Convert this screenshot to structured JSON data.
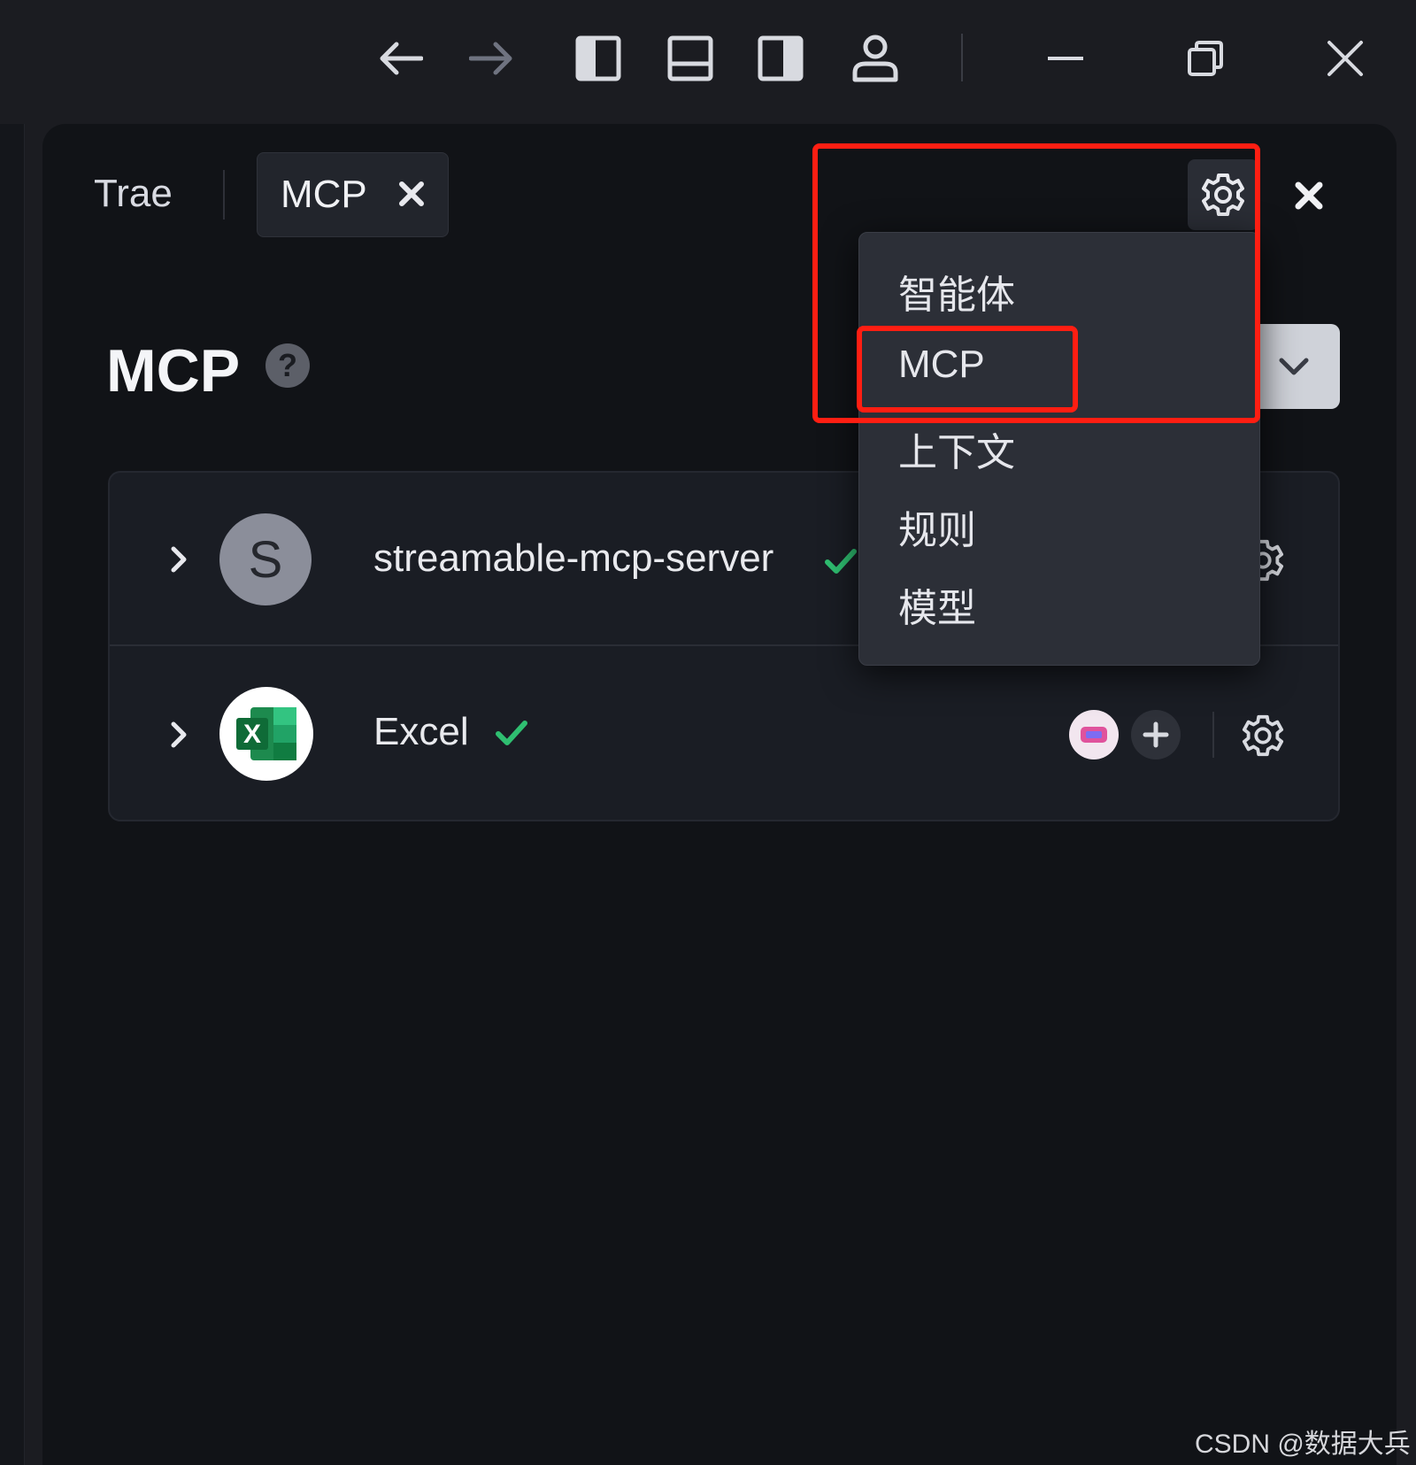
{
  "window": {
    "controls": [
      "arrow-left-icon",
      "arrow-right-icon",
      "toggle-left-panel-icon",
      "toggle-bottom-panel-icon",
      "toggle-right-panel-icon",
      "account-icon",
      "minimize-icon",
      "restore-icon",
      "close-icon"
    ]
  },
  "tabs": [
    {
      "label": "Trae",
      "active": false
    },
    {
      "label": "MCP",
      "active": true
    }
  ],
  "main": {
    "title": "MCP",
    "help_glyph": "?"
  },
  "servers": [
    {
      "avatar_letter": "S",
      "name": "streamable-mcp-server",
      "status": "connected"
    },
    {
      "avatar_letter": "X",
      "name": "Excel",
      "status": "connected"
    }
  ],
  "settings_menu": {
    "items": [
      "智能体",
      "MCP",
      "上下文",
      "规则",
      "模型"
    ],
    "highlighted": "MCP"
  },
  "watermark": "CSDN @数据大兵",
  "colors": {
    "background": "#111317",
    "titlebar": "#1b1c21",
    "highlight": "#ff1e12",
    "success": "#2fbf71",
    "excel_green": "#1d8a4e"
  }
}
